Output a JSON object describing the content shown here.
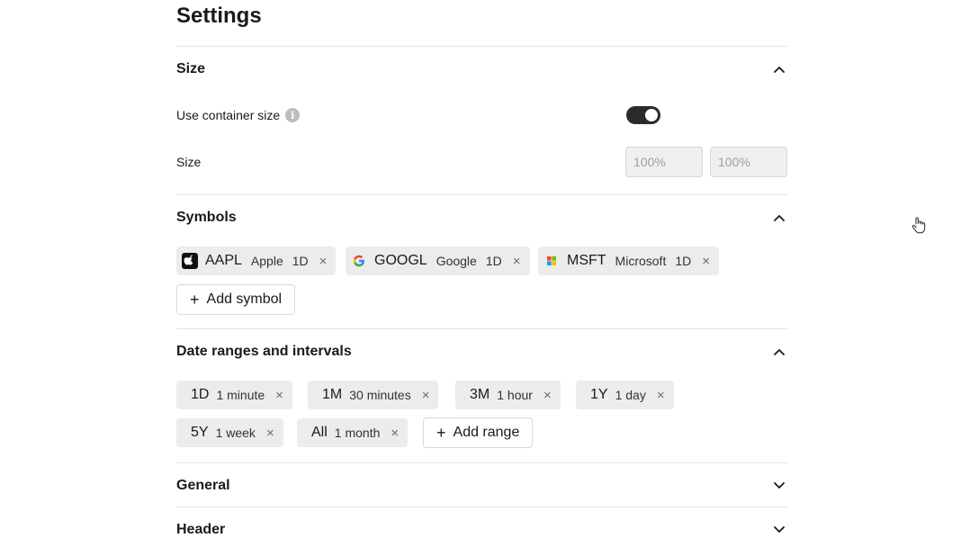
{
  "page": {
    "title": "Settings"
  },
  "sections": {
    "size": {
      "title": "Size",
      "expanded": true,
      "use_container_label": "Use container size",
      "use_container_value": true,
      "size_label": "Size",
      "width_placeholder": "100%",
      "height_placeholder": "100%"
    },
    "symbols": {
      "title": "Symbols",
      "expanded": true,
      "items": [
        {
          "ticker": "AAPL",
          "name": "Apple",
          "interval": "1D",
          "logo": "apple-logo-icon"
        },
        {
          "ticker": "GOOGL",
          "name": "Google",
          "interval": "1D",
          "logo": "google-logo-icon"
        },
        {
          "ticker": "MSFT",
          "name": "Microsoft",
          "interval": "1D",
          "logo": "microsoft-logo-icon"
        }
      ],
      "add_label": "Add symbol"
    },
    "ranges": {
      "title": "Date ranges and intervals",
      "expanded": true,
      "items": [
        {
          "range": "1D",
          "interval": "1 minute"
        },
        {
          "range": "1M",
          "interval": "30 minutes"
        },
        {
          "range": "3M",
          "interval": "1 hour"
        },
        {
          "range": "1Y",
          "interval": "1 day"
        },
        {
          "range": "5Y",
          "interval": "1 week"
        },
        {
          "range": "All",
          "interval": "1 month"
        }
      ],
      "add_label": "Add range"
    },
    "general": {
      "title": "General",
      "expanded": false
    },
    "header": {
      "title": "Header",
      "expanded": false
    }
  },
  "icons": {
    "remove": "×",
    "add": "+",
    "info": "i"
  },
  "colors": {
    "toggle_on": "#2a2a2a",
    "chip_bg": "#ececec",
    "divider": "#e4e4e4"
  }
}
